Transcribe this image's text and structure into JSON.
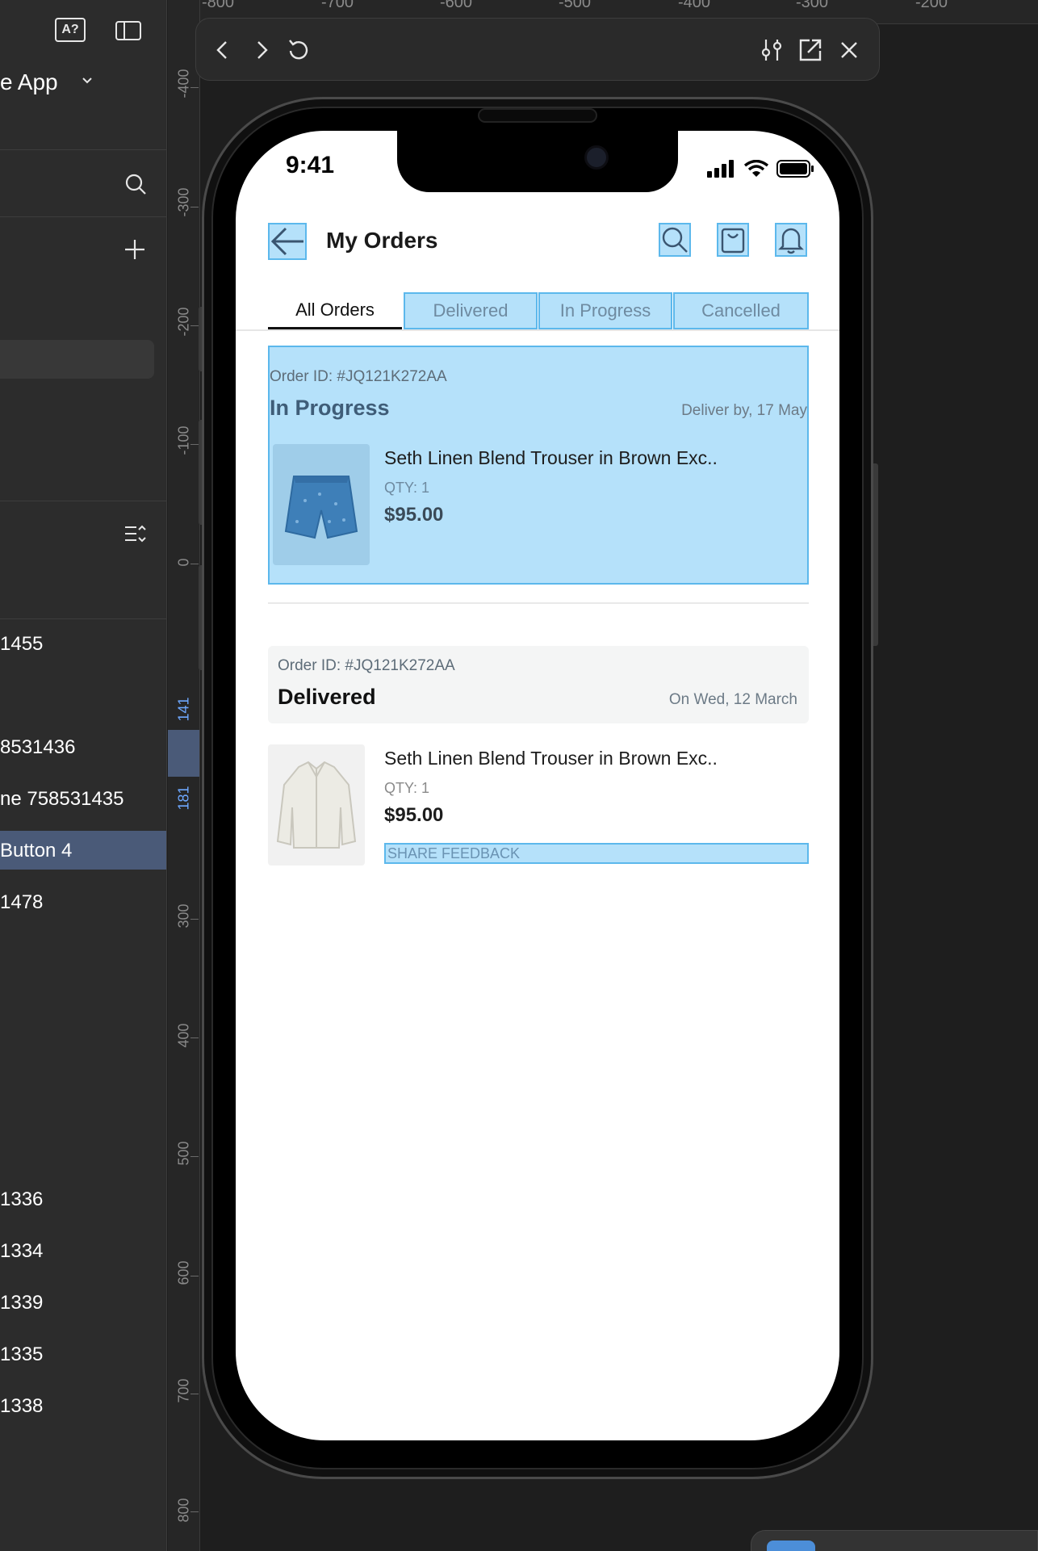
{
  "left_panel": {
    "project_name": "e App",
    "layer_items": [
      {
        "label": "1455",
        "selected": false
      },
      {
        "label": "8531436",
        "selected": false
      },
      {
        "label": "ne 758531435",
        "selected": false
      },
      {
        "label": "Button 4",
        "selected": true
      },
      {
        "label": "1478",
        "selected": false
      },
      {
        "label": "1336",
        "selected": false
      },
      {
        "label": "1334",
        "selected": false
      },
      {
        "label": "1339",
        "selected": false
      },
      {
        "label": "1335",
        "selected": false
      },
      {
        "label": "1338",
        "selected": false
      }
    ]
  },
  "rulers": {
    "horizontal": [
      "-800",
      "-700",
      "-600",
      "-500",
      "-400",
      "-300",
      "-200"
    ],
    "vertical": [
      "-400",
      "-300",
      "-200",
      "-100",
      "0",
      "141",
      "181",
      "300",
      "400",
      "500",
      "600",
      "700",
      "800"
    ]
  },
  "phone": {
    "status_time": "9:41",
    "header_title": "My Orders",
    "tabs": [
      {
        "label": "All Orders",
        "active": true
      },
      {
        "label": "Delivered",
        "active": false
      },
      {
        "label": "In Progress",
        "active": false
      },
      {
        "label": "Cancelled",
        "active": false
      }
    ],
    "orders": [
      {
        "order_id": "Order ID: #JQ121K272AA",
        "status": "In Progress",
        "date": "Deliver by, 17 May",
        "product_name": "Seth Linen Blend Trouser in Brown Exc..",
        "qty": "QTY: 1",
        "price": "$95.00"
      },
      {
        "order_id": "Order ID: #JQ121K272AA",
        "status": "Delivered",
        "date": "On Wed, 12 March",
        "product_name": "Seth Linen Blend Trouser in Brown Exc..",
        "qty": "QTY: 1",
        "price": "$95.00",
        "feedback_label": "SHARE FEEDBACK"
      }
    ]
  },
  "colors": {
    "highlight_fill": "#a8dcf7",
    "highlight_border": "#5cb8ec",
    "in_progress_text": "#3f5d78",
    "selected_layer": "#4a5a78"
  }
}
